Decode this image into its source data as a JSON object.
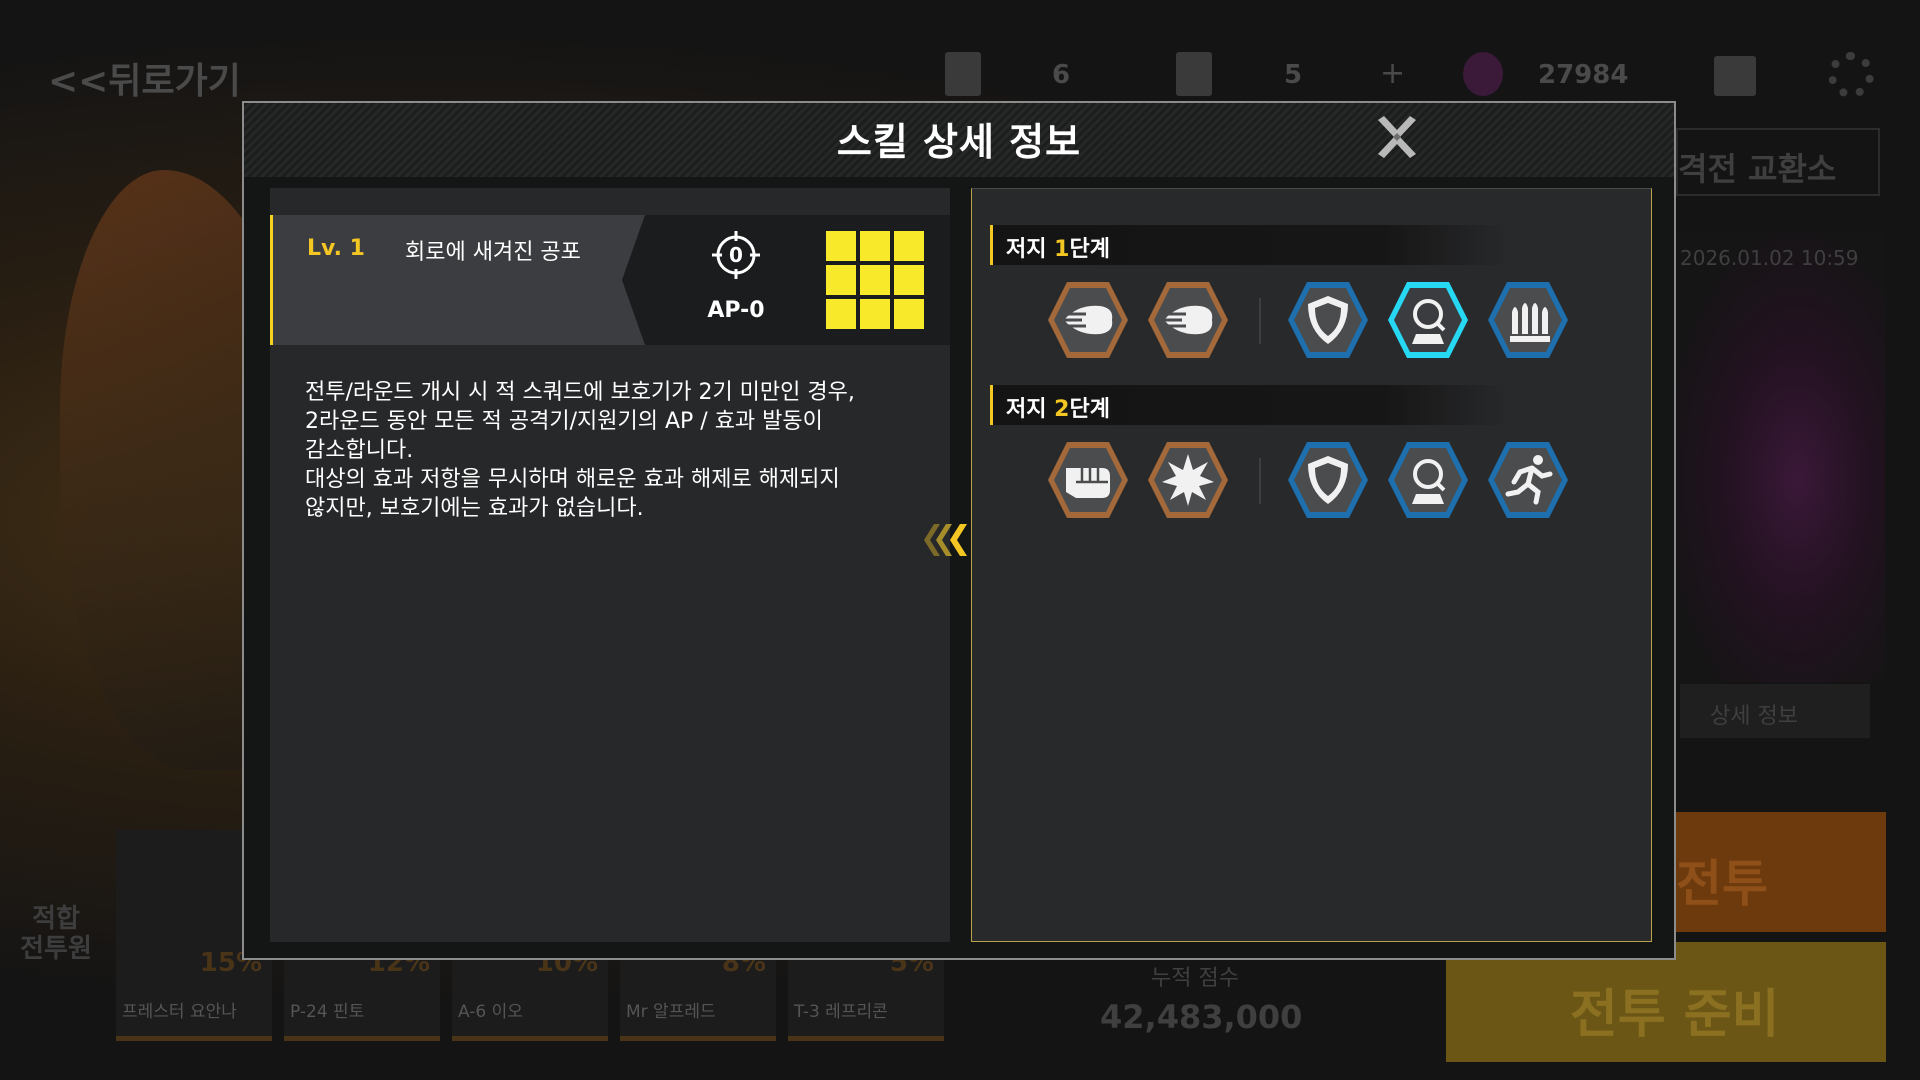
{
  "background": {
    "back_label": "<<뒤로가기",
    "resources": [
      {
        "icon": "ticket-icon",
        "value": "6"
      },
      {
        "icon": "document-icon",
        "value": "5"
      },
      {
        "icon": "gem-icon",
        "value": "27984"
      }
    ],
    "add_symbol": "+",
    "top_right_icons": [
      "clapperboard-icon",
      "gear-icon"
    ],
    "exchange_label": "격전 교환소",
    "timestamp": "2026.01.02 10:59",
    "detail_label": "상세 정보",
    "left_label": "적합\n전투원",
    "units": [
      {
        "name": "프레스터 요안나",
        "pct": "15%"
      },
      {
        "name": "P-24 핀토",
        "pct": "12%"
      },
      {
        "name": "A-6 이오",
        "pct": "10%"
      },
      {
        "name": "Mr 알프레드",
        "pct": "8%"
      },
      {
        "name": "T-3 레프리콘",
        "pct": "5%"
      }
    ],
    "score_label": "누적 점수",
    "score_value": "42,483,000",
    "battle_label": "전투",
    "ready_label": "전투 준비"
  },
  "modal": {
    "title": "스킬 상세 정보",
    "close_icon": "close-x-icon"
  },
  "skill": {
    "level": "Lv. 1",
    "name": "회로에 새겨진 공포",
    "target_icon": "crosshair-icon",
    "target_value": "0",
    "ap_label": "AP-0",
    "range_grid": [
      1,
      1,
      1,
      1,
      1,
      1,
      1,
      1,
      1
    ],
    "description": [
      "전투/라운드 개시 시 적 스쿼드에 보호기가 2기 미만인 경우,",
      "2라운드 동안 모든 적 공격기/지원기의 AP / 효과 발동이",
      "감소합니다.",
      "대상의 효과 저항을 무시하며 해로운 효과 해제로 해제되지",
      "않지만, 보호기에는 효과가 없습니다."
    ]
  },
  "stages": [
    {
      "label_prefix": "저지 ",
      "label_num": "1",
      "label_suffix": "단계",
      "debuff_icons": [
        "wind-speed-icon",
        "wind-speed-icon"
      ],
      "buff_icons": [
        "shield-icon",
        "magnifier-icon",
        "bullets-icon"
      ],
      "highlighted_icon": "magnifier-icon"
    },
    {
      "label_prefix": "저지 ",
      "label_num": "2",
      "label_suffix": "단계",
      "debuff_icons": [
        "fist-icon",
        "burst-icon"
      ],
      "buff_icons": [
        "shield-icon",
        "magnifier-icon",
        "running-icon"
      ],
      "highlighted_icon": ""
    }
  ],
  "colors": {
    "accent_yellow": "#f4c624",
    "range_yellow": "#f8ea2a",
    "debuff_bronze": "#a4693a",
    "buff_blue": "#1d6fae",
    "buff_highlight": "#27d8f2",
    "pane_bg": "#27282a"
  }
}
